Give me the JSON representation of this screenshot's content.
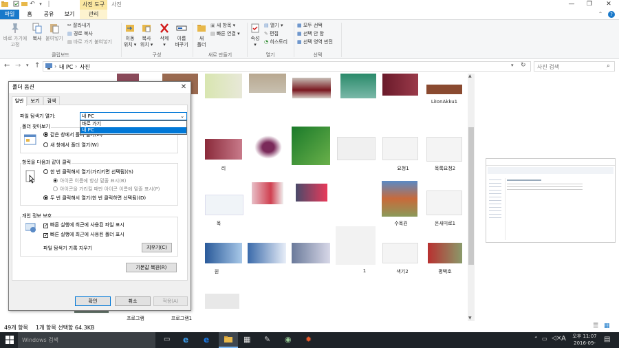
{
  "titlebar": {
    "context_tab": "사진 도구",
    "title": "사진"
  },
  "ribbon_tabs": [
    "파일",
    "홈",
    "공유",
    "보기",
    "관리"
  ],
  "ribbon": {
    "clipboard": {
      "pin": "바로 가기에\n고정",
      "copy": "복사",
      "paste": "붙여넣기",
      "cut": "잘라내기",
      "copy_path": "경로 복사",
      "paste_shortcut": "바로 가기 붙여넣기",
      "group": "클립보드"
    },
    "organize": {
      "move": "이동\n위치 ▾",
      "copy_to": "복사\n위치 ▾",
      "delete": "삭제\n▾",
      "rename": "이름\n바꾸기",
      "group": "구성"
    },
    "new": {
      "new_folder": "새\n폴더",
      "new_item": "새 항목 ▾",
      "easy_access": "빠른 연결 ▾",
      "group": "새로 만들기"
    },
    "open": {
      "properties": "속성\n▾",
      "open": "열기 ▾",
      "edit": "편집",
      "history": "히스토리",
      "group": "열기"
    },
    "select": {
      "select_all": "모두 선택",
      "select_none": "선택 안 함",
      "invert": "선택 영역 반전",
      "group": "선택"
    }
  },
  "address": {
    "path": [
      "내 PC",
      "사진"
    ],
    "search_placeholder": "사진 검색"
  },
  "files": {
    "captions": [
      "LiIonAkku1",
      "요청1",
      "목록요청2",
      "리",
      "수목원",
      "온새미로1",
      "목",
      "원",
      "색기2",
      "평택호",
      "1",
      "프로그램",
      "프로그램1"
    ]
  },
  "status": {
    "count": "49개 항목",
    "selected": "1개 항목 선택함 64.3KB"
  },
  "taskbar": {
    "search_placeholder": "Windows 검색",
    "time": "오후 11:07",
    "date": "2016-09-26",
    "ime": "A"
  },
  "dialog": {
    "title": "폴더 옵션",
    "tabs": [
      "일반",
      "보기",
      "검색"
    ],
    "open_label": "파일 탐색기 열기:",
    "open_value": "내 PC",
    "open_options": [
      "바로 가기",
      "내 PC"
    ],
    "browse_group": "폴더 찾아보기",
    "browse_same": "같은 창에서 폴더 열기(M)",
    "browse_new": "새 창에서 폴더 열기(W)",
    "click_group": "항목을 다음과 같이 클릭",
    "single_click": "한 번 클릭해서 열기(가리키면 선택됨)(S)",
    "underline_always": "아이콘 이름에 항상 밑줄 표시(B)",
    "underline_hover": "아이콘을 가리킬 때만 아이콘 이름에 밑줄 표시(P)",
    "double_click": "두 번 클릭해서 열기(한 번 클릭하면 선택됨)(D)",
    "privacy_group": "개인 정보 보호",
    "recent_files": "빠른 실행에 최근에 사용된 파일 표시",
    "recent_folders": "빠른 실행에 최근에 사용된 폴더 표시",
    "clear_history_label": "파일 탐색기 기록 지우기",
    "clear_button": "지우기(C)",
    "restore_button": "기본값 복원(R)",
    "ok": "확인",
    "cancel": "취소",
    "apply": "적용(A)"
  },
  "colors": {
    "accent": "#0078d7",
    "file_tab": "#1979ca",
    "context_tab": "#fbe7a1",
    "taskbar": "#1e2328"
  }
}
